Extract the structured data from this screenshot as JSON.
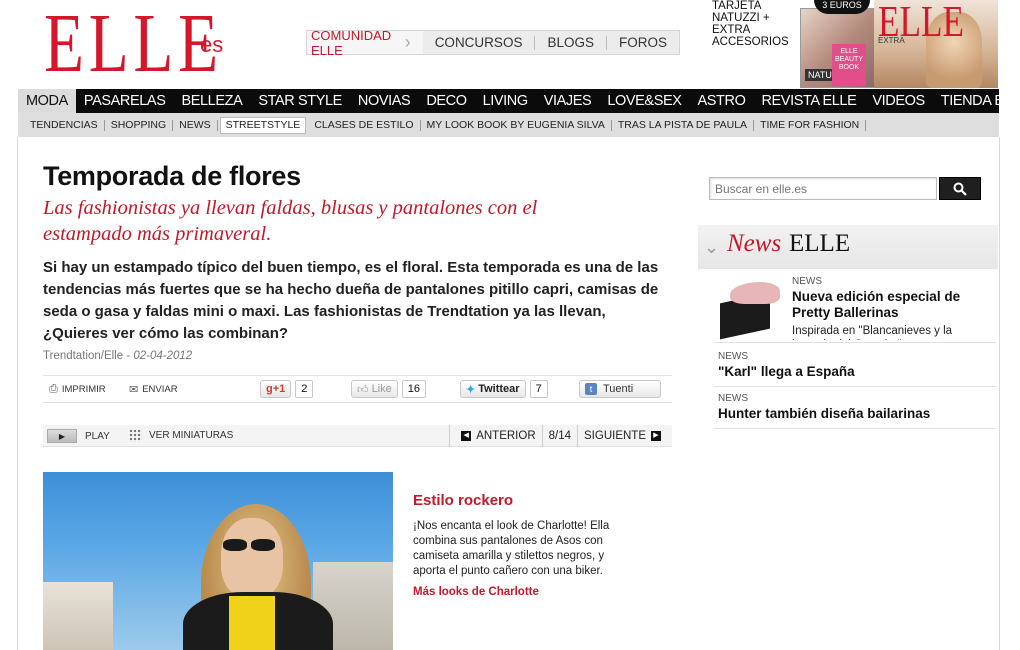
{
  "logo": {
    "brand": "ELLE",
    "locale": "es"
  },
  "topnav": {
    "comunidad": "COMUNIDAD ELLE",
    "items": [
      "CONCURSOS",
      "BLOGS",
      "FOROS"
    ]
  },
  "promo": {
    "text": "TARJETA NATUZZI + EXTRA ACCESORIOS",
    "badge": "3 EUROS",
    "mag_label": "NATUZZI",
    "book": "ELLE BEAUTY BOOK",
    "cover_brand": "ELLE",
    "cover_extra": "EXTRA"
  },
  "mainnav": [
    "MODA",
    "PASARELAS",
    "BELLEZA",
    "STAR STYLE",
    "NOVIAS",
    "DECO",
    "LIVING",
    "VIAJES",
    "LOVE&SEX",
    "ASTRO",
    "REVISTA ELLE",
    "VIDEOS",
    "TIENDA ELLE"
  ],
  "subnav": [
    "TENDENCIAS",
    "SHOPPING",
    "NEWS",
    "STREETSTYLE",
    "CLASES DE ESTILO",
    "MY LOOK BOOK BY EUGENIA SILVA",
    "TRAS LA PISTA DE PAULA",
    "TIME FOR FASHION"
  ],
  "article": {
    "title": "Temporada de flores",
    "subtitle": "Las fashionistas ya llevan faldas, blusas y pantalones con el estampado más primaveral.",
    "lead": "Si hay un estampado típico del buen tiempo, es el floral. Esta temporada es una de las tendencias más fuertes que se ha hecho dueña de pantalones pitillo capri, camisas de seda o gasa y faldas mini o maxi. Las fashionistas de Trendtation ya las llevan, ¿Quieres ver cómo las combinan?",
    "source": "Trendtation/Elle",
    "date": "02-04-2012"
  },
  "share": {
    "print": "IMPRIMIR",
    "send": "ENVIAR",
    "gplus": "+1",
    "gplus_count": "2",
    "like": "Like",
    "like_count": "16",
    "tweet": "Twittear",
    "tweet_count": "7",
    "tuenti": "Tuenti"
  },
  "gallery": {
    "play": "PLAY",
    "thumbs": "VER MINIATURAS",
    "prev": "ANTERIOR",
    "position": "8/14",
    "next": "SIGUIENTE"
  },
  "caption": {
    "title": "Estilo rockero",
    "text": "¡Nos encanta el look de Charlotte! Ella combina sus pantalones de Asos con camiseta amarilla y stilettos negros, y aporta el punto cañero con una biker.",
    "link": "Más looks de Charlotte"
  },
  "search": {
    "placeholder": "Buscar en elle.es"
  },
  "news": {
    "head_italic": "News",
    "head_brand": "ELLE",
    "items": [
      {
        "kind": "NEWS",
        "headline": "Nueva edición especial de Pretty Ballerinas",
        "desc": "Inspirada en \"Blancanieves y la leyenda del Cazador\""
      },
      {
        "kind": "NEWS",
        "headline": "\"Karl\" llega a España"
      },
      {
        "kind": "NEWS",
        "headline": "Hunter también diseña bailarinas"
      }
    ]
  }
}
